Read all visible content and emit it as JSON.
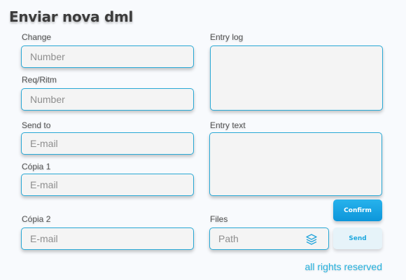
{
  "title": "Enviar nova dml",
  "fields": {
    "change": {
      "label": "Change",
      "placeholder": "Number"
    },
    "req_ritm": {
      "label": "Req/Ritm",
      "placeholder": "Number"
    },
    "send_to": {
      "label": "Send to",
      "placeholder": "E-mail"
    },
    "copia1": {
      "label": "Cópia 1",
      "placeholder": "E-mail"
    },
    "copia2": {
      "label": "Cópia 2",
      "placeholder": "E-mail"
    },
    "entry_log": {
      "label": "Entry log",
      "placeholder": ""
    },
    "entry_text": {
      "label": "Entry text",
      "placeholder": ""
    },
    "files": {
      "label": "Files",
      "placeholder": "Path",
      "icon": "layers-icon"
    }
  },
  "buttons": {
    "confirm": "Confirm",
    "send": "Send"
  },
  "footer": "all rights reserved",
  "colors": {
    "accent": "#29a9d6",
    "confirm_bg": "#1aa5e6",
    "send_bg": "#e6f3f9",
    "footer": "#26b3e0"
  }
}
